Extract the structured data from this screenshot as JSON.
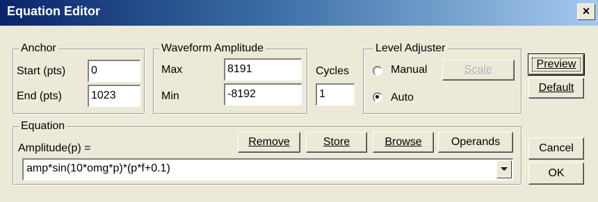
{
  "window": {
    "title": "Equation Editor",
    "close_label": "×"
  },
  "anchor": {
    "legend": "Anchor",
    "start_label": "Start (pts)",
    "start_value": "0",
    "end_label": "End  (pts)",
    "end_value": "1023"
  },
  "waveform": {
    "legend": "Waveform Amplitude",
    "max_label": "Max",
    "max_value": "8191",
    "min_label": "Min",
    "min_value": "-8192"
  },
  "cycles": {
    "label": "Cycles",
    "value": "1"
  },
  "level": {
    "legend": "Level Adjuster",
    "manual_label": "Manual",
    "auto_label": "Auto",
    "selected": "Auto",
    "scale_button": "Scale"
  },
  "buttons": {
    "preview": "Preview",
    "default": "Default",
    "cancel": "Cancel",
    "ok": "OK"
  },
  "equation": {
    "legend": "Equation",
    "amplitude_label": "Amplitude(p) =",
    "remove": "Remove",
    "store": "Store",
    "browse": "Browse",
    "operands": "Operands",
    "value": "amp*sin(10*omg*p)*(p*f+0.1)"
  }
}
